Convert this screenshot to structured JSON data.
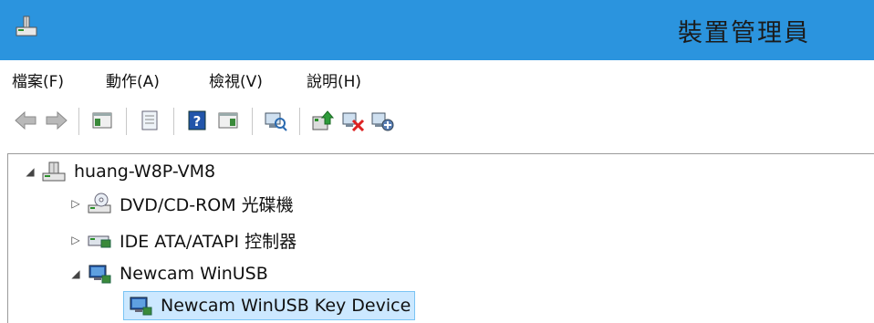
{
  "window": {
    "title": "裝置管理員"
  },
  "menu": {
    "items": [
      "檔案(F)",
      "動作(A)",
      "檢視(V)",
      "說明(H)"
    ]
  },
  "toolbar": {
    "buttons": [
      "back-arrow-icon",
      "forward-arrow-icon",
      "show-hide-tree-icon",
      "properties-icon",
      "help-icon",
      "action-pane-icon",
      "scan-hardware-icon",
      "update-driver-icon",
      "uninstall-device-icon",
      "add-legacy-hardware-icon"
    ]
  },
  "tree": {
    "root": {
      "label": "huang-W8P-VM8",
      "expanded": true
    },
    "children": [
      {
        "label": "DVD/CD-ROM 光碟機",
        "expanded": false
      },
      {
        "label": "IDE ATA/ATAPI 控制器",
        "expanded": false
      },
      {
        "label": "Newcam WinUSB",
        "expanded": true,
        "children": [
          {
            "label": "Newcam WinUSB Key Device",
            "selected": true
          }
        ]
      }
    ]
  },
  "colors": {
    "titlebar": "#2b94de",
    "selection": "#cce8ff",
    "selection_border": "#7ac4f4"
  }
}
